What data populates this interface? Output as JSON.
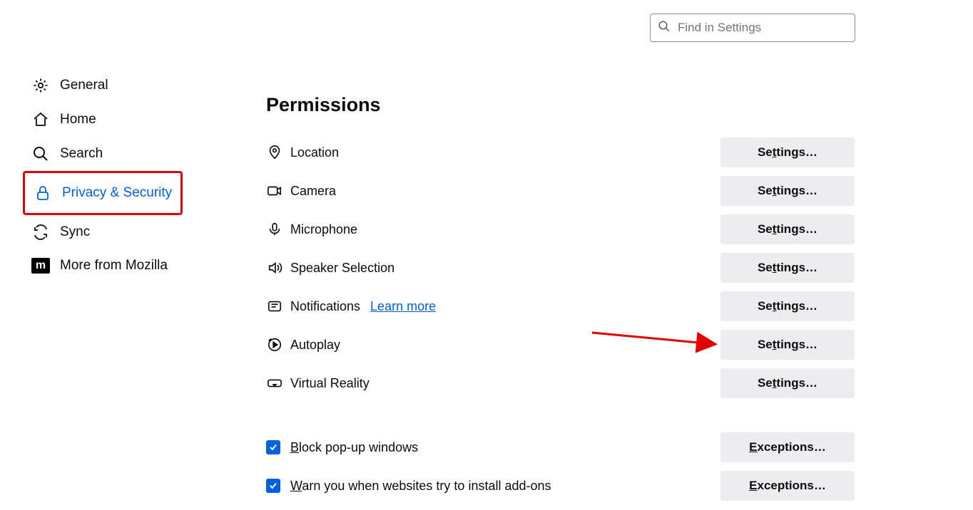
{
  "search": {
    "placeholder": "Find in Settings"
  },
  "sidebar": {
    "items": [
      {
        "label": "General"
      },
      {
        "label": "Home"
      },
      {
        "label": "Search"
      },
      {
        "label": "Privacy & Security"
      },
      {
        "label": "Sync"
      },
      {
        "label": "More from Mozilla"
      }
    ]
  },
  "section": {
    "title": "Permissions"
  },
  "permissions": [
    {
      "label": "Location",
      "button": "Settings…"
    },
    {
      "label": "Camera",
      "button": "Settings…"
    },
    {
      "label": "Microphone",
      "button": "Settings…"
    },
    {
      "label": "Speaker Selection",
      "button": "Settings…"
    },
    {
      "label": "Notifications",
      "button": "Settings…"
    },
    {
      "label": "Autoplay",
      "button": "Settings…"
    },
    {
      "label": "Virtual Reality",
      "button": "Settings…"
    }
  ],
  "learn_more": "Learn more",
  "checkboxes": [
    {
      "label_pre": "B",
      "label_rest": "lock pop-up windows",
      "button": "Exceptions…",
      "button_pre": "E",
      "button_rest": "xceptions…"
    },
    {
      "label_pre": "W",
      "label_rest": "arn you when websites try to install add-ons",
      "button": "Exceptions…",
      "button_pre": "E",
      "button_rest": "xceptions…"
    }
  ],
  "btn_pre": "Se",
  "btn_key": "t",
  "btn_rest": "tings…"
}
